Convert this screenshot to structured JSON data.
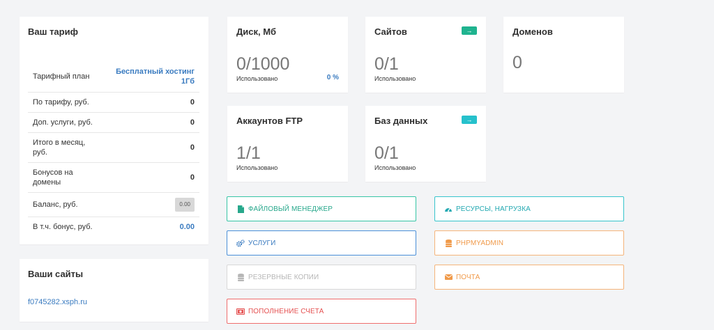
{
  "tariff": {
    "title": "Ваш тариф",
    "rows": [
      {
        "label": "Тарифный план",
        "value": "Бесплатный хостинг 1Гб"
      },
      {
        "label": "По тарифу, руб.",
        "value": "0"
      },
      {
        "label": "Доп. услуги, руб.",
        "value": "0"
      },
      {
        "label": "Итого в месяц, руб.",
        "value": "0"
      },
      {
        "label": "Бонусов на домены",
        "value": "0"
      },
      {
        "label": "Баланс, руб.",
        "value": "0.00"
      },
      {
        "label": "В т.ч. бонус, руб.",
        "value": "0.00"
      }
    ]
  },
  "sites": {
    "title": "Ваши сайты",
    "items": [
      "f0745282.xsph.ru"
    ]
  },
  "stats": {
    "disk": {
      "title": "Диск, Мб",
      "value": "0/1000",
      "used_label": "Использовано",
      "percent": "0 %"
    },
    "sites": {
      "title": "Сайтов",
      "value": "0/1",
      "used_label": "Использовано",
      "arrow": "→"
    },
    "domains": {
      "title": "Доменов",
      "value": "0"
    },
    "ftp": {
      "title": "Аккаунтов FTP",
      "value": "1/1",
      "used_label": "Использовано"
    },
    "db": {
      "title": "Баз данных",
      "value": "0/1",
      "used_label": "Использовано",
      "arrow": "→"
    }
  },
  "buttons": {
    "files": "Файловый менеджер",
    "resources": "Ресурсы, нагрузка",
    "services": "Услуги",
    "phpmyadmin": "phpMyAdmin",
    "backups": "Резервные копии",
    "mail": "Почта",
    "topup": "Пополнение счета"
  },
  "colors": {
    "teal": "#36c5a5",
    "cyan": "#36c5cc",
    "blue": "#3a7bc0",
    "orange": "#f09a4a",
    "red": "#e55050",
    "gray": "#b6b6b6"
  },
  "icons": {
    "files": "file-icon",
    "resources": "gauge-icon",
    "services": "gears-icon",
    "phpmyadmin": "database-icon",
    "backups": "database-icon",
    "mail": "envelope-icon",
    "topup": "money-icon"
  }
}
